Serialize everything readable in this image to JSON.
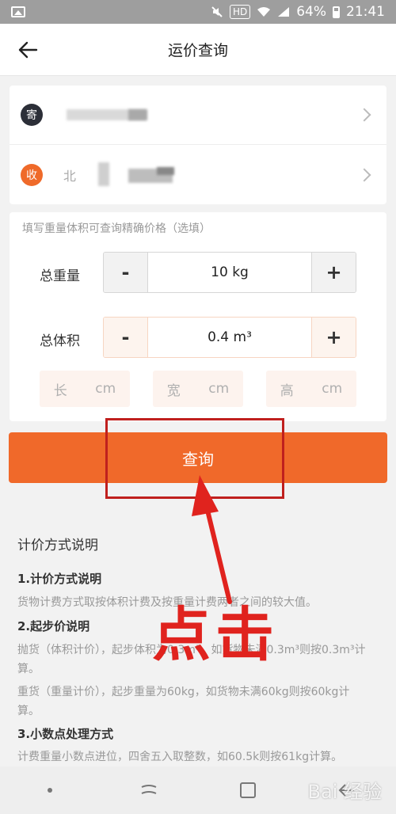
{
  "status_bar": {
    "battery": "64%",
    "time": "21:41",
    "hd": "HD"
  },
  "header": {
    "title": "运价查询"
  },
  "address": {
    "sender_badge": "寄",
    "receiver_badge": "收",
    "receiver_text_partial": "北"
  },
  "form": {
    "hint": "填写重量体积可查询精确价格（选填）",
    "weight_label": "总重量",
    "weight_value": "10 kg",
    "volume_label": "总体积",
    "volume_value": "0.4 m³",
    "minus": "-",
    "plus": "+",
    "length_label": "长",
    "width_label": "宽",
    "height_label": "高",
    "unit": "cm"
  },
  "query_button": {
    "label": "查询"
  },
  "annotation": {
    "click_text": "点击",
    "color": "#e0231e"
  },
  "info": {
    "title": "计价方式说明",
    "s1_title": "1.计价方式说明",
    "s1_text": "货物计费方式取按体积计费及按重量计费两者之间的较大值。",
    "s2_title": "2.起步价说明",
    "s2_text_a": "抛货（体积计价），起步体积为0.3m³，如货物未满0.3m³则按0.3m³计算。",
    "s2_text_b": "重货（重量计价），起步重量为60kg，如货物未满60kg则按60kg计算。",
    "s3_title": "3.小数点处理方式",
    "s3_text": "计费重量小数点进位，四舍五入取整数，如60.5k则按61kg计算。"
  },
  "watermark": "Bai 经验",
  "colors": {
    "accent": "#f0692a",
    "sender": "#2c2f38",
    "receiver": "#ef6a2a"
  }
}
